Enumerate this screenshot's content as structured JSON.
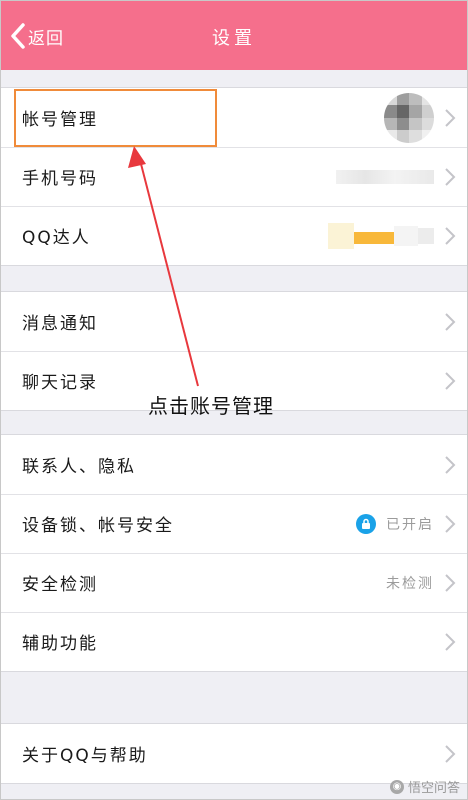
{
  "header": {
    "back_label": "返回",
    "title": "设置",
    "background_color": "#f56f8c"
  },
  "groups": [
    {
      "rows": [
        {
          "label": "帐号管理",
          "right": "avatar-blurred"
        },
        {
          "label": "手机号码",
          "right": "blurred-value"
        },
        {
          "label": "QQ达人",
          "right": "blurred-badge"
        }
      ]
    },
    {
      "rows": [
        {
          "label": "消息通知"
        },
        {
          "label": "聊天记录"
        }
      ]
    },
    {
      "rows": [
        {
          "label": "联系人、隐私"
        },
        {
          "label": "设备锁、帐号安全",
          "status": "已开启",
          "status_icon": "lock-icon"
        },
        {
          "label": "安全检测",
          "status": "未检测"
        },
        {
          "label": "辅助功能"
        }
      ]
    },
    {
      "rows": [
        {
          "label": "关于QQ与帮助"
        }
      ]
    }
  ],
  "annotation": {
    "text": "点击账号管理",
    "box_color": "#f08b3a",
    "arrow_color": "#e8383d"
  },
  "watermark": {
    "text": "悟空问答"
  }
}
